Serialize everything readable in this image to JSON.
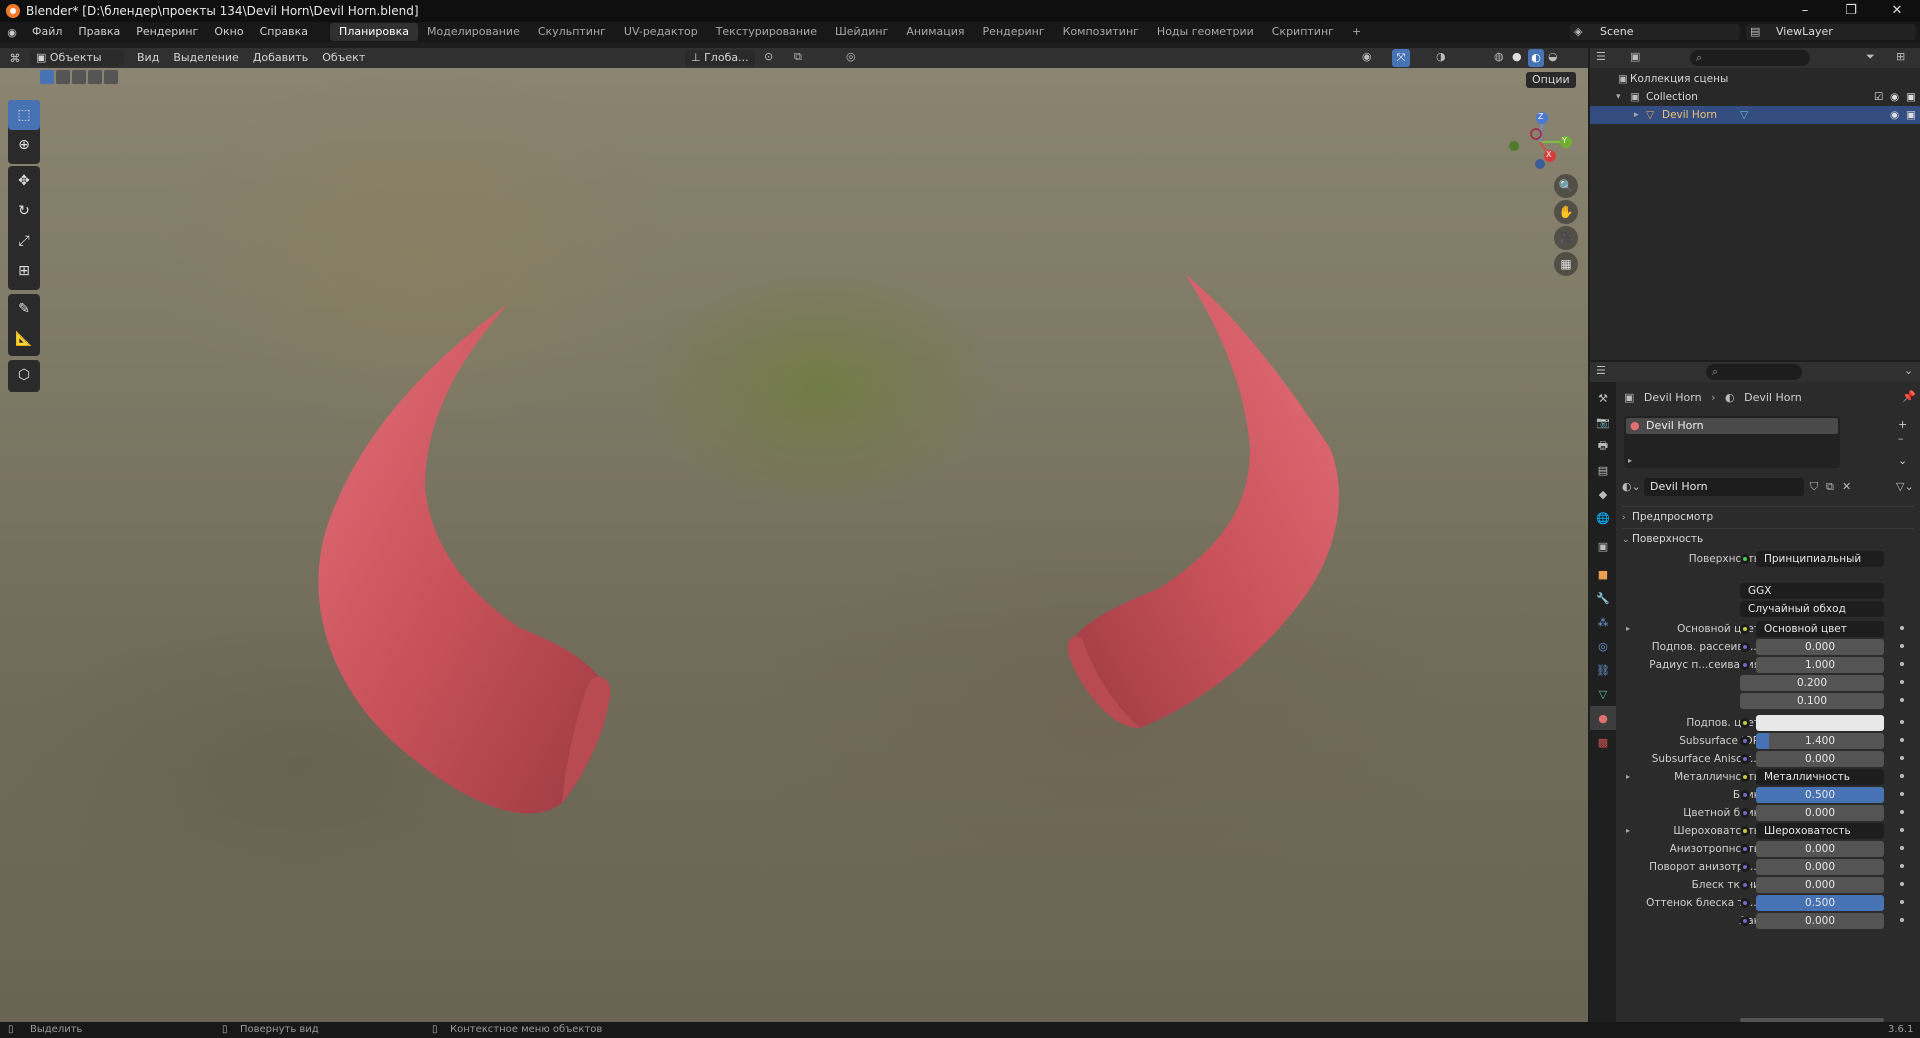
{
  "titlebar": {
    "title": "Blender* [D:\\блендер\\проекты 134\\Devil Horn\\Devil Horn.blend]",
    "minimize": "–",
    "restore": "❐",
    "close": "✕"
  },
  "menu": {
    "items": [
      "Файл",
      "Правка",
      "Рендеринг",
      "Окно",
      "Справка"
    ],
    "workspaces": [
      "Планировка",
      "Моделирование",
      "Скульптинг",
      "UV-редактор",
      "Текстурирование",
      "Шейдинг",
      "Анимация",
      "Рендеринг",
      "Композитинг",
      "Ноды геометрии",
      "Скриптинг"
    ],
    "active_workspace": "Планировка",
    "add_workspace": "+",
    "scene": "Scene",
    "view_layer": "ViewLayer"
  },
  "viewport_header": {
    "mode": "Объекты",
    "menus": [
      "Вид",
      "Выделение",
      "Добавить",
      "Объект"
    ],
    "transform_orientation": "Глоба...",
    "options": "Опции"
  },
  "gizmo": {
    "x": "X",
    "y": "Y",
    "z": "Z"
  },
  "outliner": {
    "scene_collection": "Коллекция сцены",
    "collection": "Collection",
    "object": "Devil Horn"
  },
  "properties": {
    "breadcrumb_object": "Devil Horn",
    "breadcrumb_material": "Devil Horn",
    "material_slot": "Devil Horn",
    "material_name": "Devil Horn",
    "sections": {
      "preview": "Предпросмотр",
      "surface": "Поверхность"
    },
    "surface_label": "Поверхность",
    "surface_shader": "Принципиальный BSDF",
    "distribution": "GGX",
    "subsurface_method": "Случайный обход",
    "rows": [
      {
        "label": "Основной цвет",
        "value": "Основной цвет",
        "kind": "link",
        "expand": true
      },
      {
        "label": "Подпов. рассеива...",
        "value": "0.000",
        "kind": "num"
      },
      {
        "label": "Радиус п...сеивания",
        "value": "1.000",
        "kind": "num"
      },
      {
        "label": "",
        "value": "0.200",
        "kind": "num"
      },
      {
        "label": "",
        "value": "0.100",
        "kind": "num"
      },
      {
        "label": "Подпов. цвет",
        "value": "",
        "kind": "color"
      },
      {
        "label": "Subsurface IOR",
        "value": "1.400",
        "kind": "num",
        "fill": 0.1
      },
      {
        "label": "Subsurface Anisotr...",
        "value": "0.000",
        "kind": "num"
      },
      {
        "label": "Металличность",
        "value": "Металличность",
        "kind": "link",
        "expand": true
      },
      {
        "label": "Блик",
        "value": "0.500",
        "kind": "num",
        "fill": 1.0
      },
      {
        "label": "Цветной блик",
        "value": "0.000",
        "kind": "num"
      },
      {
        "label": "Шероховатость",
        "value": "Шероховатость",
        "kind": "link",
        "expand": true
      },
      {
        "label": "Анизотропность",
        "value": "0.000",
        "kind": "num"
      },
      {
        "label": "Поворот анизотро...",
        "value": "0.000",
        "kind": "num"
      },
      {
        "label": "Блеск ткани",
        "value": "0.000",
        "kind": "num"
      },
      {
        "label": "Оттенок блеска тк...",
        "value": "0.500",
        "kind": "num",
        "fill": 1.0
      },
      {
        "label": "Лак",
        "value": "0.000",
        "kind": "num"
      }
    ]
  },
  "statusbar": {
    "select": "Выделить",
    "rotate": "Повернуть вид",
    "context_menu": "Контекстное меню объектов",
    "version": "3.6.1"
  },
  "colors": {
    "accent": "#4772b3",
    "horn": "#c9525a",
    "selected_row": "#334d80"
  }
}
